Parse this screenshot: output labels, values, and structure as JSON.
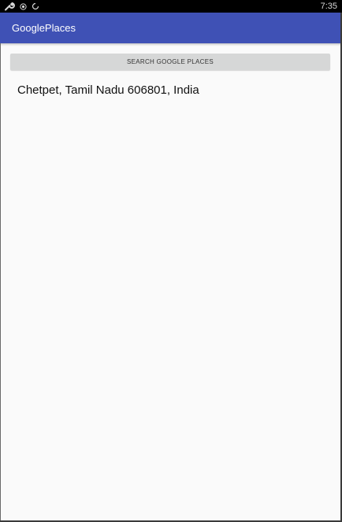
{
  "status_bar": {
    "time": "7:35",
    "icons": [
      "wrench-icon",
      "record-icon",
      "sync-icon"
    ]
  },
  "app_bar": {
    "title": "GooglePlaces",
    "color": "#3f51b5"
  },
  "main": {
    "search_button_label": "SEARCH GOOGLE PLACES",
    "selected_place": "Chetpet, Tamil Nadu 606801, India"
  }
}
